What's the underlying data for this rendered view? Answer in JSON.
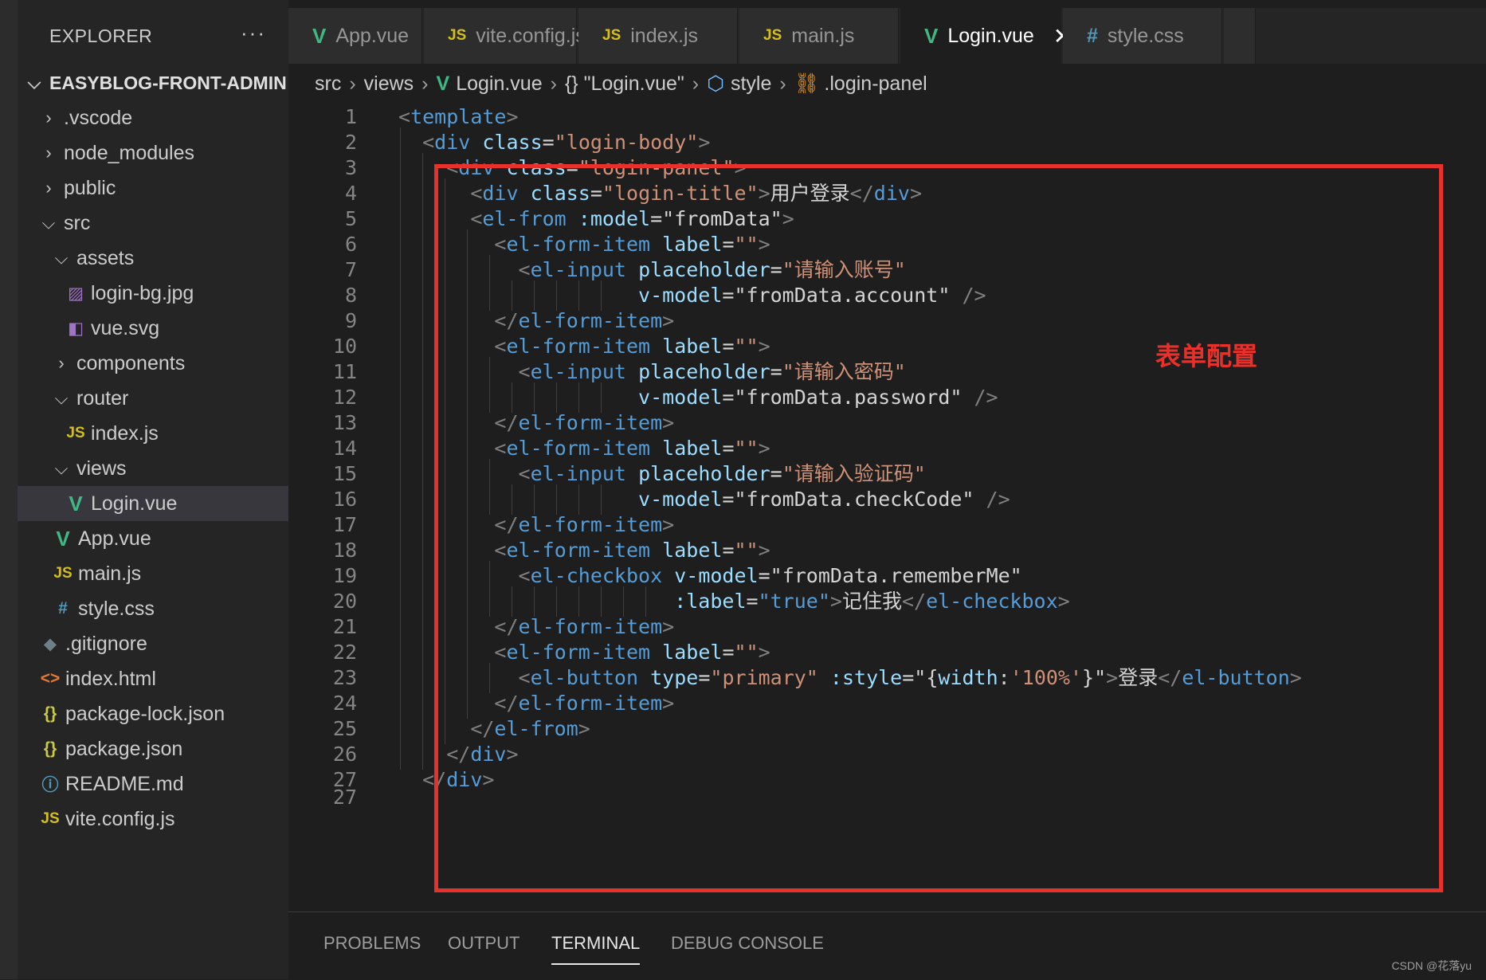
{
  "explorer": {
    "header": "EXPLORER",
    "more": "···",
    "items": [
      {
        "label": "EASYBLOG-FRONT-ADMIN",
        "chevron": "⌵",
        "icon": "",
        "icon_name": ""
      },
      {
        "label": ".vscode",
        "chevron": "›",
        "icon": "",
        "icon_name": ""
      },
      {
        "label": "node_modules",
        "chevron": "›",
        "icon": "",
        "icon_name": ""
      },
      {
        "label": "public",
        "chevron": "›",
        "icon": "",
        "icon_name": ""
      },
      {
        "label": "src",
        "chevron": "⌵",
        "icon": "",
        "icon_name": ""
      },
      {
        "label": "assets",
        "chevron": "⌵",
        "icon": "",
        "icon_name": ""
      },
      {
        "label": "login-bg.jpg",
        "chevron": "",
        "icon": "▨",
        "icon_name": "image-file-icon"
      },
      {
        "label": "vue.svg",
        "chevron": "",
        "icon": "◧",
        "icon_name": "svg-file-icon"
      },
      {
        "label": "components",
        "chevron": "›",
        "icon": "",
        "icon_name": ""
      },
      {
        "label": "router",
        "chevron": "⌵",
        "icon": "",
        "icon_name": ""
      },
      {
        "label": "index.js",
        "chevron": "",
        "icon": "JS",
        "icon_name": "js-file-icon"
      },
      {
        "label": "views",
        "chevron": "⌵",
        "icon": "",
        "icon_name": ""
      },
      {
        "label": "Login.vue",
        "chevron": "",
        "icon": "V",
        "icon_name": "vue-file-icon"
      },
      {
        "label": "App.vue",
        "chevron": "",
        "icon": "V",
        "icon_name": "vue-file-icon"
      },
      {
        "label": "main.js",
        "chevron": "",
        "icon": "JS",
        "icon_name": "js-file-icon"
      },
      {
        "label": "style.css",
        "chevron": "",
        "icon": "#",
        "icon_name": "css-file-icon"
      },
      {
        "label": ".gitignore",
        "chevron": "",
        "icon": "◆",
        "icon_name": "git-file-icon"
      },
      {
        "label": "index.html",
        "chevron": "",
        "icon": "<>",
        "icon_name": "html-file-icon"
      },
      {
        "label": "package-lock.json",
        "chevron": "",
        "icon": "{}",
        "icon_name": "json-file-icon"
      },
      {
        "label": "package.json",
        "chevron": "",
        "icon": "{}",
        "icon_name": "json-file-icon"
      },
      {
        "label": "README.md",
        "chevron": "",
        "icon": "ⓘ",
        "icon_name": "info-file-icon"
      },
      {
        "label": "vite.config.js",
        "chevron": "",
        "icon": "JS",
        "icon_name": "js-file-icon"
      }
    ]
  },
  "tabs": [
    {
      "label": "App.vue",
      "icon": "V",
      "icon_name": "vue-file-icon",
      "active": false
    },
    {
      "label": "vite.config.js",
      "icon": "JS",
      "icon_name": "js-file-icon",
      "active": false
    },
    {
      "label": "index.js",
      "icon": "JS",
      "icon_name": "js-file-icon",
      "active": false
    },
    {
      "label": "main.js",
      "icon": "JS",
      "icon_name": "js-file-icon",
      "active": false
    },
    {
      "label": "Login.vue",
      "icon": "V",
      "icon_name": "vue-file-icon",
      "active": true,
      "close": "✕"
    },
    {
      "label": "style.css",
      "icon": "#",
      "icon_name": "css-file-icon",
      "active": false
    }
  ],
  "breadcrumb": {
    "src": "src",
    "views": "views",
    "file": "Login.vue",
    "object": "{} \"Login.vue\"",
    "style": "style",
    "selector": ".login-panel",
    "sep": "›"
  },
  "code": {
    "lines": [
      [
        [
          "t-punc",
          "<"
        ],
        [
          "t-tag",
          "template"
        ],
        [
          "t-punc",
          ">"
        ]
      ],
      [
        [
          "t-text",
          "  "
        ],
        [
          "t-punc",
          "<"
        ],
        [
          "t-tag",
          "div"
        ],
        [
          "t-text",
          " "
        ],
        [
          "t-attr",
          "class"
        ],
        [
          "t-text",
          "="
        ],
        [
          "t-str",
          "\"login-body\""
        ],
        [
          "t-punc",
          ">"
        ]
      ],
      [
        [
          "t-text",
          "    "
        ],
        [
          "t-punc",
          "<"
        ],
        [
          "t-tag",
          "div"
        ],
        [
          "t-text",
          " "
        ],
        [
          "t-attr",
          "class"
        ],
        [
          "t-text",
          "="
        ],
        [
          "t-str",
          "\"login-panel\""
        ],
        [
          "t-punc",
          ">"
        ]
      ],
      [
        [
          "t-text",
          "      "
        ],
        [
          "t-punc",
          "<"
        ],
        [
          "t-tag",
          "div"
        ],
        [
          "t-text",
          " "
        ],
        [
          "t-attr",
          "class"
        ],
        [
          "t-text",
          "="
        ],
        [
          "t-str",
          "\"login-title\""
        ],
        [
          "t-punc",
          ">"
        ],
        [
          "t-text",
          "用户登录"
        ],
        [
          "t-punc",
          "</"
        ],
        [
          "t-tag",
          "div"
        ],
        [
          "t-punc",
          ">"
        ]
      ],
      [
        [
          "t-text",
          "      "
        ],
        [
          "t-punc",
          "<"
        ],
        [
          "t-tag",
          "el-from"
        ],
        [
          "t-text",
          " "
        ],
        [
          "t-attr",
          ":model"
        ],
        [
          "t-text",
          "="
        ],
        [
          "t-text",
          "\"fromData\""
        ],
        [
          "t-punc",
          ">"
        ]
      ],
      [
        [
          "t-text",
          "        "
        ],
        [
          "t-punc",
          "<"
        ],
        [
          "t-tag",
          "el-form-item"
        ],
        [
          "t-text",
          " "
        ],
        [
          "t-attr",
          "label"
        ],
        [
          "t-text",
          "="
        ],
        [
          "t-str",
          "\"\""
        ],
        [
          "t-punc",
          ">"
        ]
      ],
      [
        [
          "t-text",
          "          "
        ],
        [
          "t-punc",
          "<"
        ],
        [
          "t-tag",
          "el-input"
        ],
        [
          "t-text",
          " "
        ],
        [
          "t-attr",
          "placeholder"
        ],
        [
          "t-text",
          "="
        ],
        [
          "t-str",
          "\"请输入账号\""
        ]
      ],
      [
        [
          "t-text",
          "                    "
        ],
        [
          "t-attr",
          "v-model"
        ],
        [
          "t-text",
          "="
        ],
        [
          "t-text",
          "\"fromData.account\""
        ],
        [
          "t-text",
          " "
        ],
        [
          "t-punc",
          "/>"
        ]
      ],
      [
        [
          "t-text",
          "        "
        ],
        [
          "t-punc",
          "</"
        ],
        [
          "t-tag",
          "el-form-item"
        ],
        [
          "t-punc",
          ">"
        ]
      ],
      [
        [
          "t-text",
          "        "
        ],
        [
          "t-punc",
          "<"
        ],
        [
          "t-tag",
          "el-form-item"
        ],
        [
          "t-text",
          " "
        ],
        [
          "t-attr",
          "label"
        ],
        [
          "t-text",
          "="
        ],
        [
          "t-str",
          "\"\""
        ],
        [
          "t-punc",
          ">"
        ]
      ],
      [
        [
          "t-text",
          "          "
        ],
        [
          "t-punc",
          "<"
        ],
        [
          "t-tag",
          "el-input"
        ],
        [
          "t-text",
          " "
        ],
        [
          "t-attr",
          "placeholder"
        ],
        [
          "t-text",
          "="
        ],
        [
          "t-str",
          "\"请输入密码\""
        ]
      ],
      [
        [
          "t-text",
          "                    "
        ],
        [
          "t-attr",
          "v-model"
        ],
        [
          "t-text",
          "="
        ],
        [
          "t-text",
          "\"fromData.password\""
        ],
        [
          "t-text",
          " "
        ],
        [
          "t-punc",
          "/>"
        ]
      ],
      [
        [
          "t-text",
          "        "
        ],
        [
          "t-punc",
          "</"
        ],
        [
          "t-tag",
          "el-form-item"
        ],
        [
          "t-punc",
          ">"
        ]
      ],
      [
        [
          "t-text",
          "        "
        ],
        [
          "t-punc",
          "<"
        ],
        [
          "t-tag",
          "el-form-item"
        ],
        [
          "t-text",
          " "
        ],
        [
          "t-attr",
          "label"
        ],
        [
          "t-text",
          "="
        ],
        [
          "t-str",
          "\"\""
        ],
        [
          "t-punc",
          ">"
        ]
      ],
      [
        [
          "t-text",
          "          "
        ],
        [
          "t-punc",
          "<"
        ],
        [
          "t-tag",
          "el-input"
        ],
        [
          "t-text",
          " "
        ],
        [
          "t-attr",
          "placeholder"
        ],
        [
          "t-text",
          "="
        ],
        [
          "t-str",
          "\"请输入验证码\""
        ]
      ],
      [
        [
          "t-text",
          "                    "
        ],
        [
          "t-attr",
          "v-model"
        ],
        [
          "t-text",
          "="
        ],
        [
          "t-text",
          "\"fromData.checkCode\""
        ],
        [
          "t-text",
          " "
        ],
        [
          "t-punc",
          "/>"
        ]
      ],
      [
        [
          "t-text",
          "        "
        ],
        [
          "t-punc",
          "</"
        ],
        [
          "t-tag",
          "el-form-item"
        ],
        [
          "t-punc",
          ">"
        ]
      ],
      [
        [
          "t-text",
          "        "
        ],
        [
          "t-punc",
          "<"
        ],
        [
          "t-tag",
          "el-form-item"
        ],
        [
          "t-text",
          " "
        ],
        [
          "t-attr",
          "label"
        ],
        [
          "t-text",
          "="
        ],
        [
          "t-str",
          "\"\""
        ],
        [
          "t-punc",
          ">"
        ]
      ],
      [
        [
          "t-text",
          "          "
        ],
        [
          "t-punc",
          "<"
        ],
        [
          "t-tag",
          "el-checkbox"
        ],
        [
          "t-text",
          " "
        ],
        [
          "t-attr",
          "v-model"
        ],
        [
          "t-text",
          "="
        ],
        [
          "t-text",
          "\"fromData.rememberMe\""
        ]
      ],
      [
        [
          "t-text",
          "                       "
        ],
        [
          "t-attr",
          ":label"
        ],
        [
          "t-text",
          "="
        ],
        [
          "t-tag",
          "\"true\""
        ],
        [
          "t-punc",
          ">"
        ],
        [
          "t-text",
          "记住我"
        ],
        [
          "t-punc",
          "</"
        ],
        [
          "t-tag",
          "el-checkbox"
        ],
        [
          "t-punc",
          ">"
        ]
      ],
      [
        [
          "t-text",
          "        "
        ],
        [
          "t-punc",
          "</"
        ],
        [
          "t-tag",
          "el-form-item"
        ],
        [
          "t-punc",
          ">"
        ]
      ],
      [
        [
          "t-text",
          "        "
        ],
        [
          "t-punc",
          "<"
        ],
        [
          "t-tag",
          "el-form-item"
        ],
        [
          "t-text",
          " "
        ],
        [
          "t-attr",
          "label"
        ],
        [
          "t-text",
          "="
        ],
        [
          "t-str",
          "\"\""
        ],
        [
          "t-punc",
          ">"
        ]
      ],
      [
        [
          "t-text",
          "          "
        ],
        [
          "t-punc",
          "<"
        ],
        [
          "t-tag",
          "el-button"
        ],
        [
          "t-text",
          " "
        ],
        [
          "t-attr",
          "type"
        ],
        [
          "t-text",
          "="
        ],
        [
          "t-str",
          "\"primary\""
        ],
        [
          "t-text",
          " "
        ],
        [
          "t-attr",
          ":style"
        ],
        [
          "t-text",
          "=\"{"
        ],
        [
          "t-attr",
          "width"
        ],
        [
          "t-text",
          ":"
        ],
        [
          "t-str",
          "'100%'"
        ],
        [
          "t-text",
          "}\""
        ],
        [
          "t-punc",
          ">"
        ],
        [
          "t-text",
          "登录"
        ],
        [
          "t-punc",
          "</"
        ],
        [
          "t-tag",
          "el-button"
        ],
        [
          "t-punc",
          ">"
        ]
      ],
      [
        [
          "t-text",
          "        "
        ],
        [
          "t-punc",
          "</"
        ],
        [
          "t-tag",
          "el-form-item"
        ],
        [
          "t-punc",
          ">"
        ]
      ],
      [
        [
          "t-text",
          "      "
        ],
        [
          "t-punc",
          "</"
        ],
        [
          "t-tag",
          "el-from"
        ],
        [
          "t-punc",
          ">"
        ]
      ],
      [
        [
          "t-text",
          "    "
        ],
        [
          "t-punc",
          "</"
        ],
        [
          "t-tag",
          "div"
        ],
        [
          "t-punc",
          ">"
        ]
      ],
      [
        [
          "t-text",
          "  "
        ],
        [
          "t-punc",
          "</"
        ],
        [
          "t-tag",
          "div"
        ],
        [
          "t-punc",
          ">"
        ]
      ]
    ]
  },
  "annotation": "表单配置",
  "panel": {
    "tabs": [
      "PROBLEMS",
      "OUTPUT",
      "TERMINAL",
      "DEBUG CONSOLE"
    ],
    "active": "TERMINAL"
  },
  "watermark": "CSDN @花落yu",
  "colors": {
    "highlight": "#e8312b",
    "vue_green": "#41b883",
    "js_yellow": "#d4bf1d",
    "css_blue": "#519aba"
  }
}
